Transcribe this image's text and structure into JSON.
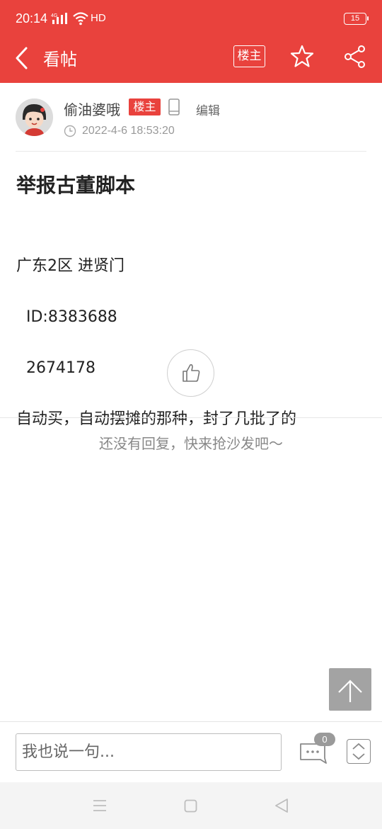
{
  "status_bar": {
    "time": "20:14",
    "network": "HD",
    "battery": "15"
  },
  "header": {
    "title": "看帖",
    "op_label": "楼主",
    "icons": [
      "back-icon",
      "star-icon",
      "share-icon"
    ],
    "background": "#e9423d"
  },
  "post": {
    "author": "偷油婆哦",
    "author_tag": "楼主",
    "edit_label": "编辑",
    "time": "2022-4-6 18:53:20",
    "title": "举报古董脚本",
    "body_lines": [
      "广东2区 进贤门",
      "  ID:8383688",
      "  2674178",
      "自动买，自动摆摊的那种，封了几批了的"
    ]
  },
  "replies": {
    "empty_text": "还没有回复，快来抢沙发吧～"
  },
  "bottom_bar": {
    "input_placeholder": "我也说一句...",
    "comment_count": "0"
  },
  "colors": {
    "accent": "#e9423d",
    "muted_text": "#888888",
    "top_button_bg": "#a3a3a3"
  }
}
